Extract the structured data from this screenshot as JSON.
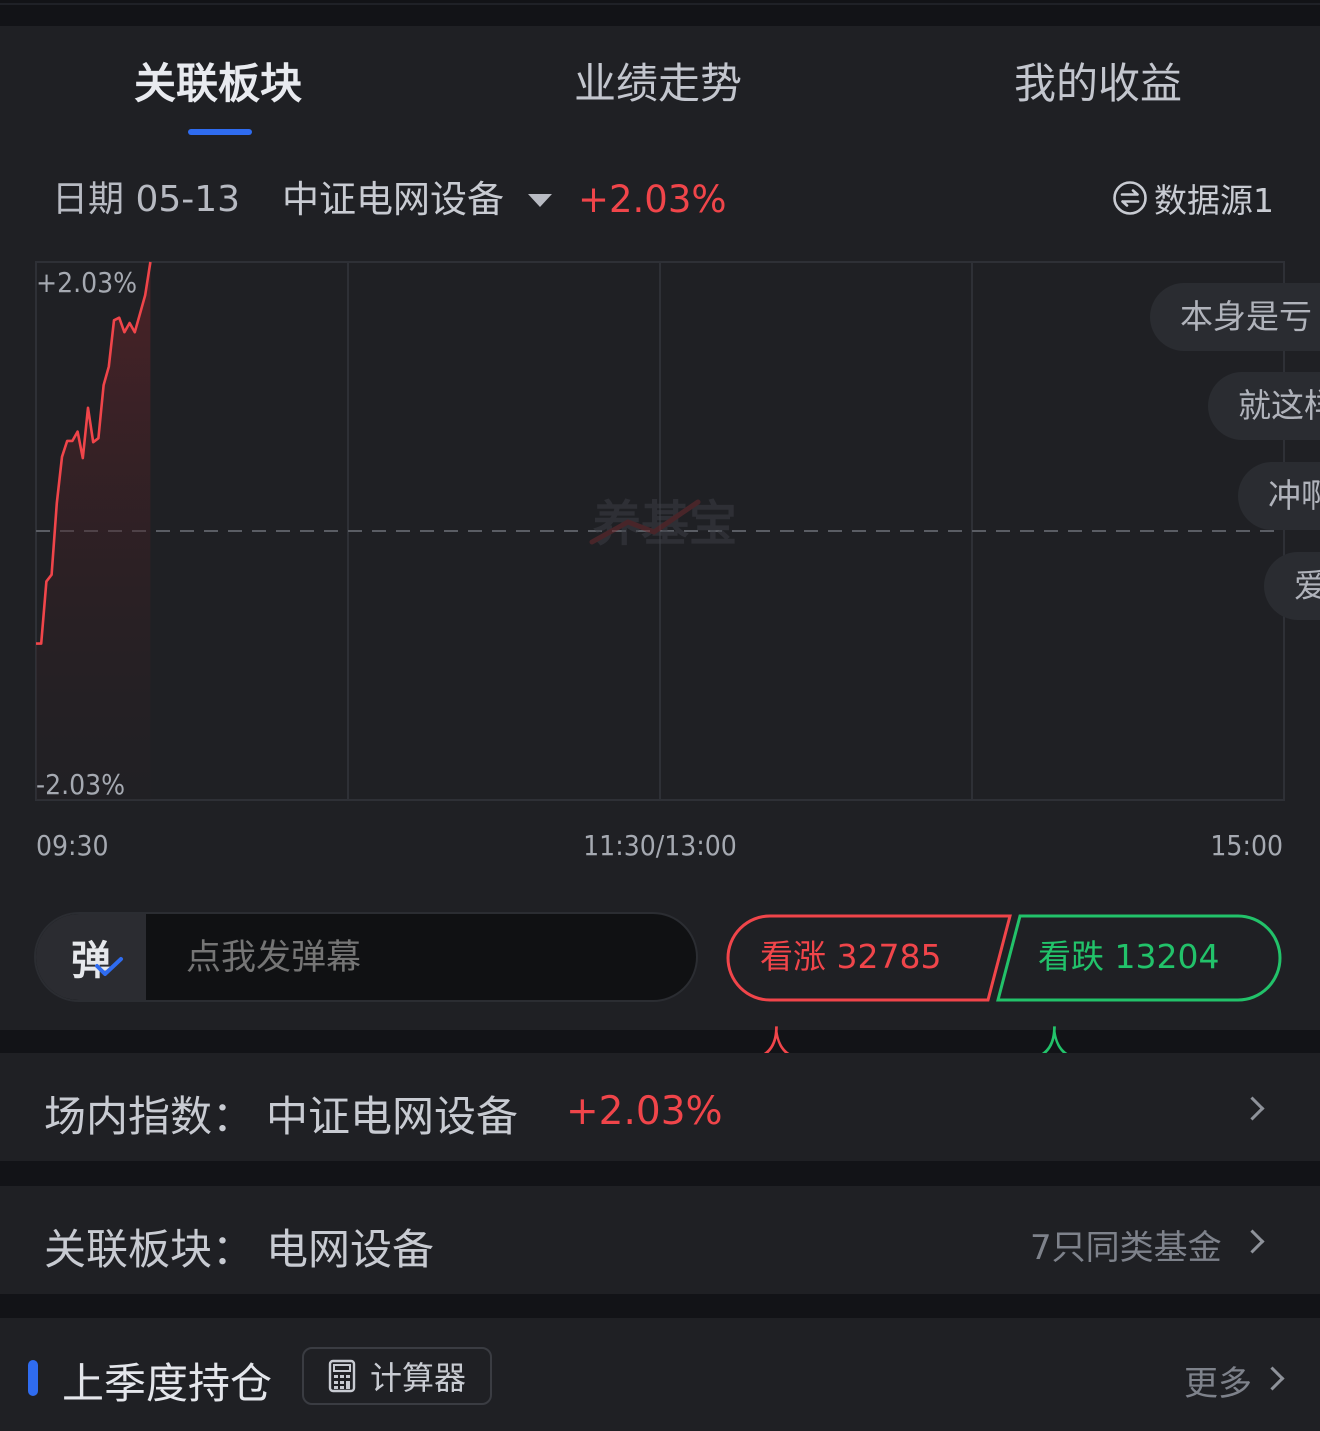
{
  "tabs": [
    {
      "label": "关联板块",
      "active": true
    },
    {
      "label": "业绩走势",
      "active": false
    },
    {
      "label": "我的收益",
      "active": false
    }
  ],
  "info": {
    "date": "日期 05-13",
    "index_name": "中证电网设备",
    "change": "+2.03%",
    "source": "数据源1"
  },
  "chart_data": {
    "type": "line",
    "x_ticks": [
      "09:30",
      "11:30/13:00",
      "15:00"
    ],
    "y_top_label": "+2.03%",
    "y_bottom_label": "-2.03%",
    "ylim": [
      -2.03,
      2.03
    ],
    "x_range_minutes": 240,
    "baseline_percent": 0,
    "series": [
      {
        "points": [
          [
            0,
            -0.85
          ],
          [
            1,
            -0.85
          ],
          [
            2,
            -0.38
          ],
          [
            3,
            -0.33
          ],
          [
            4,
            0.21
          ],
          [
            5,
            0.56
          ],
          [
            6,
            0.68
          ],
          [
            7,
            0.68
          ],
          [
            8,
            0.75
          ],
          [
            9,
            0.55
          ],
          [
            10,
            0.93
          ],
          [
            11,
            0.67
          ],
          [
            12,
            0.7
          ],
          [
            13,
            1.1
          ],
          [
            14,
            1.24
          ],
          [
            15,
            1.59
          ],
          [
            16,
            1.61
          ],
          [
            17,
            1.5
          ],
          [
            18,
            1.57
          ],
          [
            19,
            1.5
          ],
          [
            20,
            1.64
          ],
          [
            21,
            1.78
          ],
          [
            22,
            2.03
          ]
        ]
      }
    ],
    "colors": {
      "line": "#f0454a",
      "grid": "#2e3036",
      "axis_text": "#a5a9b1"
    },
    "watermark": "养基宝"
  },
  "danmaku": [
    "本身是亏",
    "就这样",
    "冲啊",
    "爱"
  ],
  "comment": {
    "button": "弹",
    "placeholder": "点我发弹幕"
  },
  "vote": {
    "up": "看涨 32785 人",
    "down": "看跌 13204 人",
    "up_color": "#f0454a",
    "down_color": "#22c26a"
  },
  "index_row": {
    "title": "场内指数：",
    "name": "中证电网设备",
    "change": "+2.03%"
  },
  "sector_row": {
    "title": "关联板块：",
    "name": "电网设备",
    "link": "7只同类基金"
  },
  "holdings_row": {
    "title": "上季度持仓",
    "calc_label": "计算器",
    "more": "更多"
  },
  "icons": [
    "swap-icon",
    "calculator-icon",
    "chevron-right-icon",
    "check-icon"
  ]
}
